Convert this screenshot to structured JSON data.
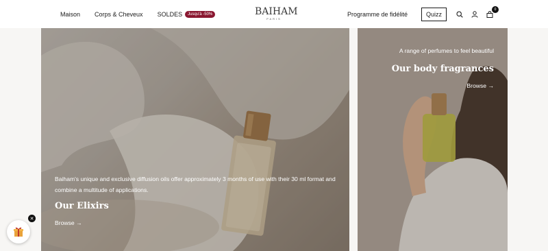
{
  "header": {
    "nav": [
      {
        "label": "Maison"
      },
      {
        "label": "Corps & Cheveux"
      },
      {
        "label": "SOLDES"
      }
    ],
    "sale_badge": "Jusqu'à -50%",
    "logo": {
      "main": "BAIHAM",
      "sub": "PARIS"
    },
    "loyalty_label": "Programme de fidélité",
    "quizz_label": "Quizz",
    "cart_count": "0",
    "icons": [
      "search-icon",
      "account-icon",
      "cart-icon"
    ]
  },
  "panels": {
    "left": {
      "description": "Baiham's unique and exclusive diffusion oils offer approximately 3 months of use with their 30 ml format and combine a multitude of applications.",
      "title": "Our Elixirs",
      "browse": "Browse →"
    },
    "right": {
      "subtitle": "A range of perfumes to feel beautiful",
      "title": "Our body fragrances",
      "browse": "Browse →"
    }
  },
  "widget": {
    "icon": "gift-icon",
    "close": "✕"
  },
  "colors": {
    "badge": "#8a1730",
    "header_bg": "#ffffff",
    "page_bg": "#f7f6f4"
  }
}
